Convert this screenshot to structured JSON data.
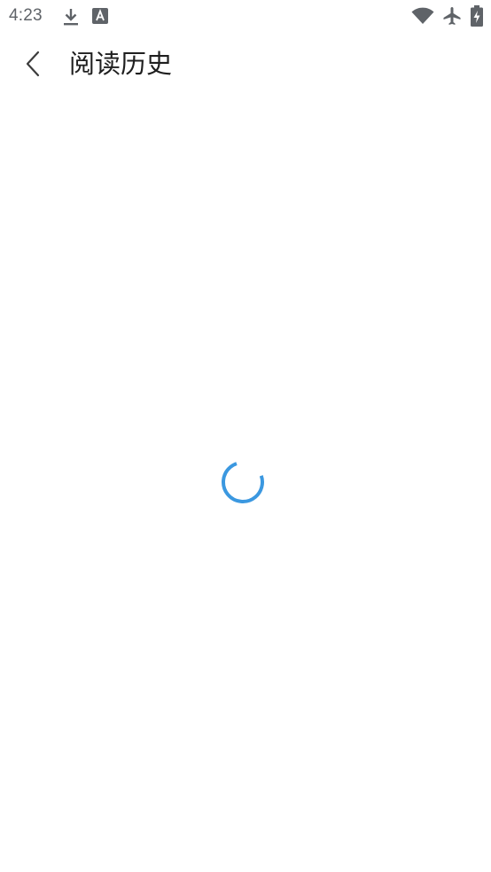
{
  "status_bar": {
    "time": "4:23",
    "notification_icons": [
      "download-icon",
      "translate-a-icon"
    ],
    "system_icons": [
      "wifi-icon",
      "airplane-mode-icon",
      "battery-charging-icon"
    ]
  },
  "app_bar": {
    "back_icon": "chevron-left-icon",
    "title": "阅读历史"
  },
  "content": {
    "state": "loading",
    "spinner_color": "#3b98e0"
  },
  "colors": {
    "background": "#ffffff",
    "status_icon": "#5f6368",
    "title_text": "#1f1f1f",
    "accent": "#3b98e0"
  }
}
